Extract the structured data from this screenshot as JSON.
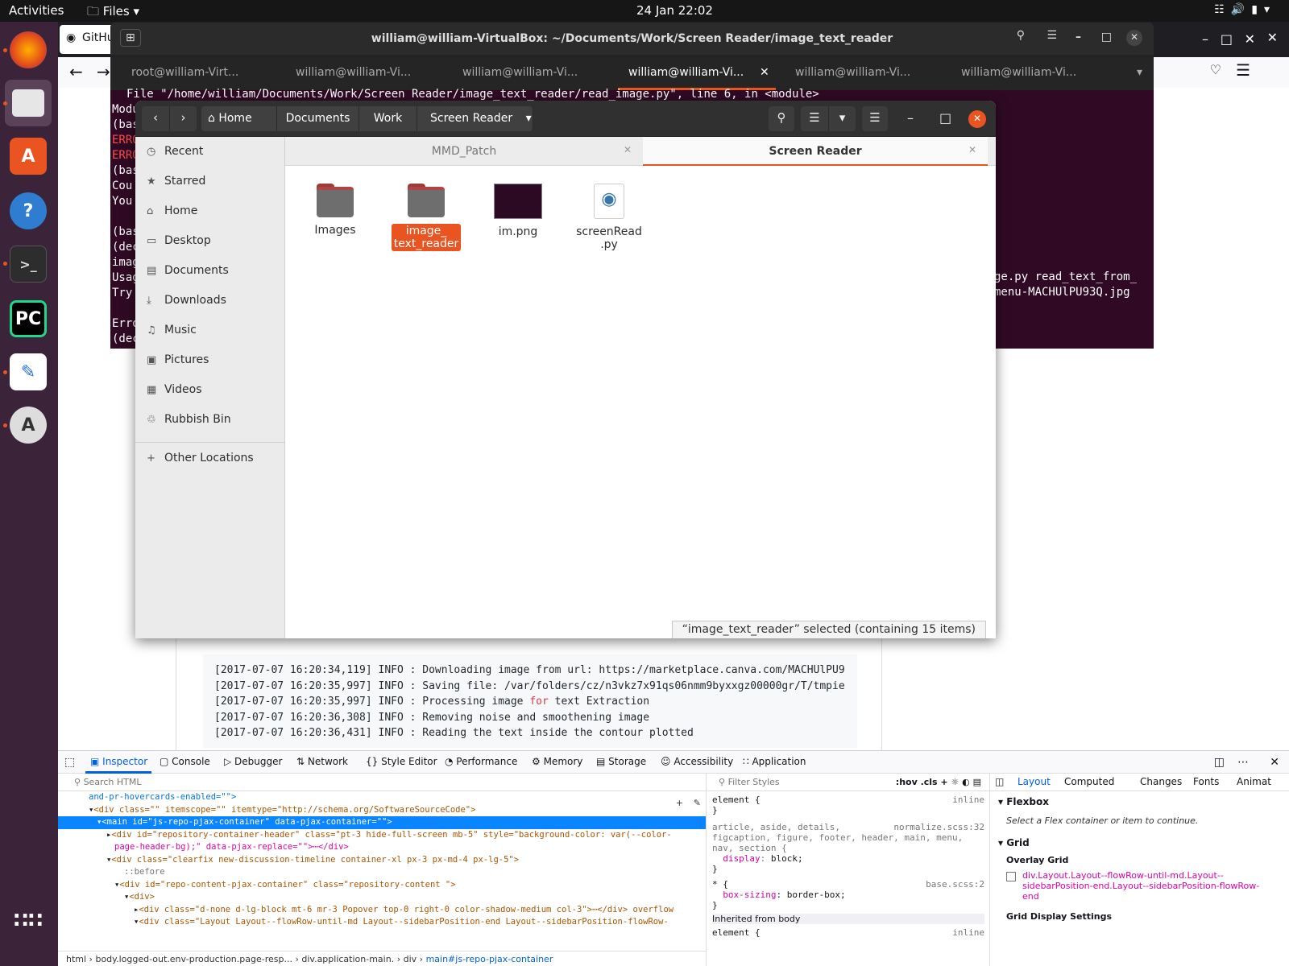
{
  "topbar": {
    "activities": "Activities",
    "files_menu": "Files",
    "clock": "24 Jan  22:02"
  },
  "browser": {
    "tab_title": "GitHu",
    "log_lines": [
      {
        "pre": "[2017-07-07 16:20:34,119] INFO : Downloading image from url: https://marketplace.canva.com/MACHUlPU9",
        "kw": "",
        "post": ""
      },
      {
        "pre": "[2017-07-07 16:20:35,997] INFO : Saving file: /var/folders/cz/n3vkz7x91qs06nmm9byxxgz00000gr/T/tmpie",
        "kw": "",
        "post": ""
      },
      {
        "pre": "[2017-07-07 16:20:35,997] INFO : Processing image ",
        "kw": "for",
        "post": " text Extraction"
      },
      {
        "pre": "[2017-07-07 16:20:36,308] INFO : Removing noise and smoothening image",
        "kw": "",
        "post": ""
      },
      {
        "pre": "[2017-07-07 16:20:36,431] INFO : Reading the text inside the contour plotted",
        "kw": "",
        "post": ""
      }
    ]
  },
  "devtools": {
    "tabs": [
      "Inspector",
      "Console",
      "Debugger",
      "Network",
      "Style Editor",
      "Performance",
      "Memory",
      "Storage",
      "Accessibility",
      "Application"
    ],
    "search_placeholder": "Search HTML",
    "html_lines": [
      "and-pr-hovercards-enabled=\"\">",
      "<div class=\"\" itemscope=\"\" itemtype=\"http://schema.org/SoftwareSourceCode\">",
      "<main id=\"js-repo-pjax-container\" data-pjax-container=\"\">",
      "<div id=\"repository-container-header\" class=\"pt-3 hide-full-screen mb-5\" style=\"background-color: var(--color-",
      "page-header-bg);\" data-pjax-replace=\"\">⋯</div>",
      "<div class=\"clearfix new-discussion-timeline container-xl px-3 px-md-4 px-lg-5\">",
      "::before",
      "<div id=\"repo-content-pjax-container\" class=\"repository-content \">",
      "<div>",
      "<div class=\"d-none d-lg-block mt-6 mr-3 Popover top-0 right-0 color-shadow-medium col-3\">⋯</div> overflow",
      "<div class=\"Layout Layout--flowRow-until-md Layout--sidebarPosition-end Layout--sidebarPosition-flowRow-"
    ],
    "breadcrumbs": [
      "html",
      "body.logged-out.env-production.page-resp...",
      "div.application-main.",
      "div",
      "main#js-repo-pjax-container"
    ],
    "filter_styles": "Filter Styles",
    "rules": {
      "r1_sel": "element {",
      "r1_src": "inline",
      "r1_end": "}",
      "r2_sel": "article, aside, details, figcaption, figure, footer, header, main, menu, nav, section {",
      "r2_src": "normalize.scss:32",
      "r2_prop": "display",
      "r2_val": "block;",
      "r2_end": "}",
      "r3_sel": "* {",
      "r3_src": "base.scss:2",
      "r3_prop": "box-sizing",
      "r3_val": "border-box;",
      "r3_end": "}",
      "inherited": "Inherited from body",
      "r4_sel": "element {",
      "r4_src": "inline"
    },
    "layout_tabs": [
      "Layout",
      "Computed",
      "Changes",
      "Fonts",
      "Animat"
    ],
    "flexbox": "Flexbox",
    "flex_msg": "Select a Flex container or item to continue.",
    "grid": "Grid",
    "overlay_grid": "Overlay Grid",
    "grid_item": "div.Layout.Layout--flowRow-until-md.Layout--sidebarPosition-end.Layout--sidebarPosition-flowRow-end",
    "grid_display": "Grid Display Settings"
  },
  "terminal": {
    "title": "william@william-VirtualBox: ~/Documents/Work/Screen Reader/image_text_reader",
    "tabs": [
      "root@william-Virt...",
      "william@william-Vi...",
      "william@william-Vi...",
      "william@william-Vi...",
      "william@william-Vi...",
      "william@william-Vi..."
    ],
    "line_file": "File \"/home/william/Documents/Work/Screen Reader/image_text_reader/read_image.py\", line 6, in <module>",
    "left_lines": [
      "Modu",
      "(bas",
      "ERRO",
      "ERRO",
      "(bas",
      "Cou",
      "You",
      "",
      "(bas",
      "(dec",
      "imag",
      "Usag",
      "Try",
      "",
      "Erro",
      "(dec"
    ],
    "right_lines": [
      "ge.py read_text_from_",
      "menu-MACHUlPU93Q.jpg"
    ]
  },
  "file_manager": {
    "path": [
      "Home",
      "Documents",
      "Work",
      "Screen Reader"
    ],
    "sidebar": [
      {
        "icon": "clock-icon",
        "glyph": "◷",
        "label": "Recent"
      },
      {
        "icon": "star-icon",
        "glyph": "★",
        "label": "Starred"
      },
      {
        "icon": "home-icon",
        "glyph": "⌂",
        "label": "Home"
      },
      {
        "icon": "desktop-icon",
        "glyph": "▭",
        "label": "Desktop"
      },
      {
        "icon": "documents-icon",
        "glyph": "▤",
        "label": "Documents"
      },
      {
        "icon": "downloads-icon",
        "glyph": "⤓",
        "label": "Downloads"
      },
      {
        "icon": "music-icon",
        "glyph": "♫",
        "label": "Music"
      },
      {
        "icon": "pictures-icon",
        "glyph": "▣",
        "label": "Pictures"
      },
      {
        "icon": "videos-icon",
        "glyph": "▦",
        "label": "Videos"
      },
      {
        "icon": "trash-icon",
        "glyph": "♲",
        "label": "Rubbish Bin"
      },
      {
        "icon": "plus-icon",
        "glyph": "+",
        "label": "Other Locations"
      }
    ],
    "tabs": [
      "MMD_Patch",
      "Screen Reader"
    ],
    "files": [
      {
        "name": "Images",
        "type": "folder"
      },
      {
        "name": "image_\ntext_reader",
        "type": "folder"
      },
      {
        "name": "im.png",
        "type": "image"
      },
      {
        "name": "screenRead\n.py",
        "type": "python"
      }
    ],
    "status": "“image_text_reader” selected  (containing 15 items)"
  },
  "colors": {
    "accent": "#e95420",
    "devtools_blue": "#0061e0",
    "terminal_bg": "#300a24"
  }
}
